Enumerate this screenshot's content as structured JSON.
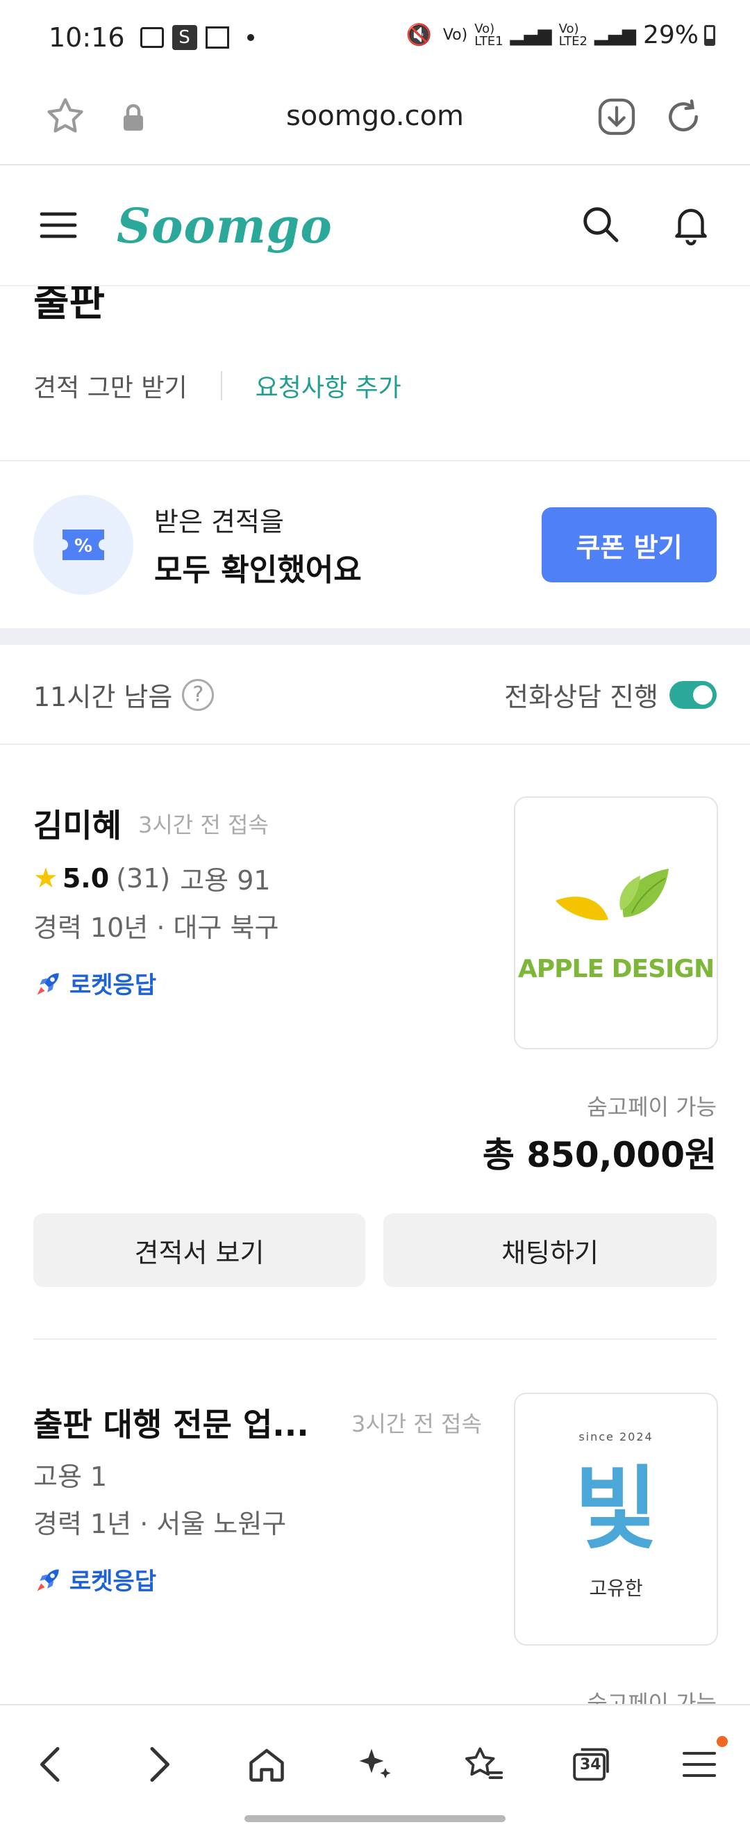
{
  "status_bar": {
    "time": "10:16",
    "battery": "29%"
  },
  "browser": {
    "url": "soomgo.com"
  },
  "app": {
    "logo": "Soomgo"
  },
  "request": {
    "title": "출판",
    "action_stop": "견적 그만 받기",
    "action_add": "요청사항 추가"
  },
  "coupon": {
    "line1": "받은 견적을",
    "line2": "모두 확인했어요",
    "button": "쿠폰 받기"
  },
  "timebar": {
    "remaining": "11시간 남음",
    "help": "?",
    "phone_consult": "전화상담 진행",
    "phone_consult_on": true
  },
  "quotes": [
    {
      "name": "김미혜",
      "seen": "3시간 전 접속",
      "rating": "5.0",
      "reviews": "(31)",
      "hires": "고용 91",
      "career": "경력 10년 · 대구 북구",
      "badge": "로켓응답",
      "thumb_text": "APPLE DESIGN",
      "pay": "숨고페이 가능",
      "price": "총 850,000원",
      "btn_view": "견적서 보기",
      "btn_chat": "채팅하기"
    },
    {
      "name": "출판 대행 전문 업...",
      "seen": "3시간 전 접속",
      "hires": "고용 1",
      "career": "경력 1년 · 서울 노원구",
      "badge": "로켓응답",
      "thumb_since": "since 2024",
      "thumb_big": "빛",
      "thumb_small": "고유한",
      "pay": "숨고페이 가능"
    }
  ],
  "bottom_nav": {
    "tabs_count": "34"
  },
  "colors": {
    "brand": "#2aa89a",
    "primary_button": "#4f80f5",
    "badge_blue": "#1e62d8"
  }
}
